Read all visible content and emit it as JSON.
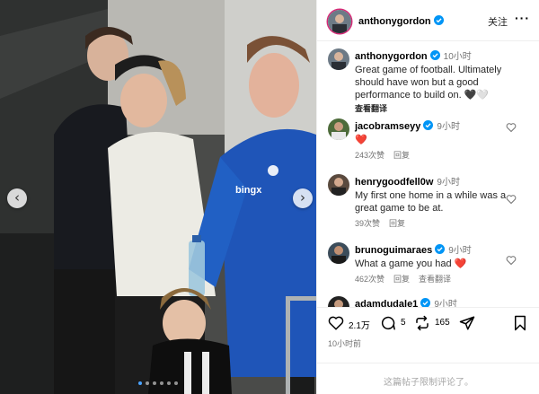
{
  "post": {
    "username": "anthonygordon",
    "follow_label": "关注",
    "more_icon": "more-horizontal-icon"
  },
  "colors": {
    "verified": "#0095f6",
    "heart_red": "#ed4956",
    "link": "#4aa3ff",
    "muted": "#737373"
  },
  "caption": {
    "username": "anthonygordon",
    "time": "10小时",
    "text": "Great game of football. Ultimately should have won but a good performance to build on. 🖤🤍",
    "translate": "查看翻译"
  },
  "comments": [
    {
      "username": "jacobramseyy",
      "time": "9小时",
      "text": "❤️",
      "likes": "243次赞",
      "reply": "回复",
      "translate": ""
    },
    {
      "username": "henrygoodfell0w",
      "time": "9小时",
      "text": "My first one home in a while was a great game to be at.",
      "likes": "39次赞",
      "reply": "回复",
      "translate": ""
    },
    {
      "username": "brunoguimaraes",
      "time": "9小时",
      "text": "What a game you had ❤️",
      "likes": "462次赞",
      "reply": "回复",
      "translate": "查看翻译"
    },
    {
      "username": "adamdudale1",
      "time": "9小时",
      "text": "",
      "likes": "",
      "reply": "",
      "translate": ""
    }
  ],
  "actions": {
    "like_count": "2.1万",
    "comment_count": "5",
    "repost_count": "165"
  },
  "post_time": "10小时前",
  "comments_disabled_note": "这篇帖子限制评论了。",
  "carousel": {
    "slide_count": 6,
    "active_index": 0
  },
  "photo_text": {
    "jersey_sponsor": "bingx"
  }
}
